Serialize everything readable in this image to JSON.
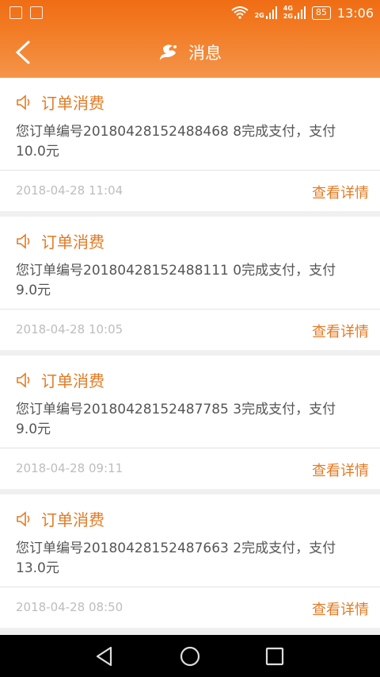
{
  "statusbar": {
    "network_1": "2G",
    "network_2_top": "4G",
    "network_2_bottom": "2G",
    "battery": "85",
    "time": "13:06"
  },
  "header": {
    "title": "消息",
    "back_icon": "chevron-left-icon",
    "logo_icon": "brand-logo-icon"
  },
  "messages": [
    {
      "title": "订单消费",
      "body_line1": "您订单编号20180428152488468 8完成支付，支付",
      "body_line2": "10.0元",
      "time": "2018-04-28 11:04",
      "link": "查看详情"
    },
    {
      "title": "订单消费",
      "body_line1": "您订单编号20180428152488111 0完成支付，支付",
      "body_line2": "9.0元",
      "time": "2018-04-28 10:05",
      "link": "查看详情"
    },
    {
      "title": "订单消费",
      "body_line1": "您订单编号20180428152487785 3完成支付，支付",
      "body_line2": "9.0元",
      "time": "2018-04-28 09:11",
      "link": "查看详情"
    },
    {
      "title": "订单消费",
      "body_line1": "您订单编号20180428152487663 2完成支付，支付",
      "body_line2": "13.0元",
      "time": "2018-04-28 08:50",
      "link": "查看详情"
    }
  ],
  "colors": {
    "accent": "#e27b24",
    "header": "#f27a22"
  }
}
